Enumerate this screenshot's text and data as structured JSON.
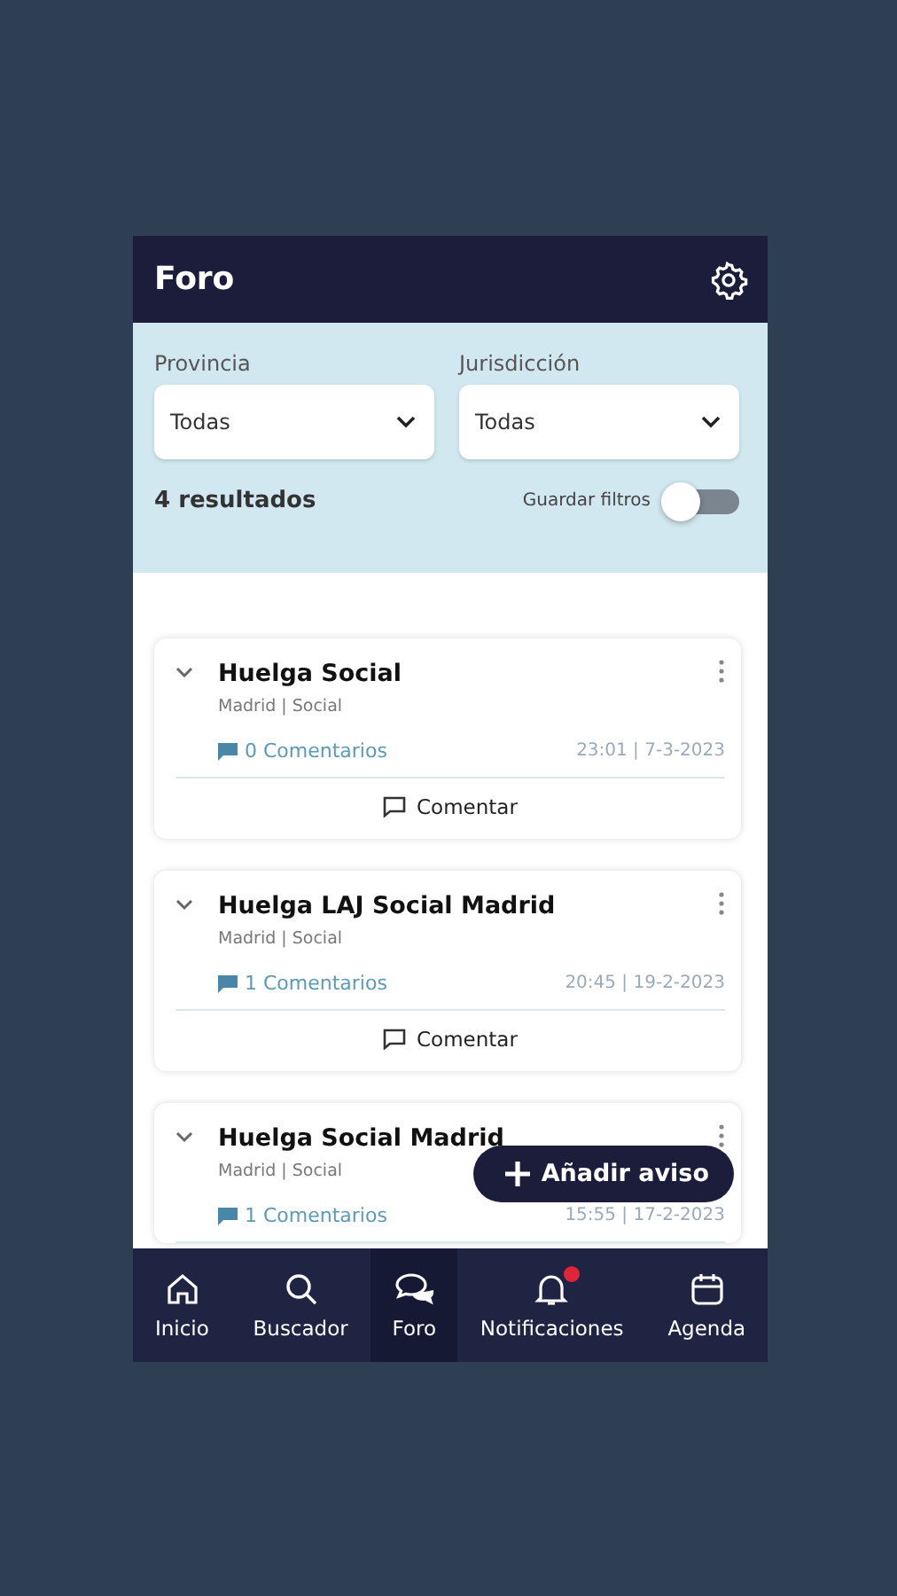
{
  "header": {
    "title": "Foro"
  },
  "filters": [
    {
      "label": "Provincia",
      "value": "Todas"
    },
    {
      "label": "Jurisdicción",
      "value": "Todas"
    }
  ],
  "results": "4 resultados",
  "save_filters": {
    "label": "Guardar filtros",
    "on": false
  },
  "posts": [
    {
      "title": "Huelga Social",
      "meta": "Madrid | Social",
      "comments": "0 Comentarios",
      "time": "23:01 | 7-3-2023",
      "action": "Comentar",
      "expanded": false
    },
    {
      "title": "Huelga LAJ Social Madrid",
      "meta": "Madrid | Social",
      "comments": "1 Comentarios",
      "time": "20:45 | 19-2-2023",
      "action": "Comentar",
      "expanded": false
    },
    {
      "title": "Huelga Social Madrid",
      "meta": "Madrid | Social",
      "comments": "1 Comentarios",
      "time": "15:55 | 17-2-2023",
      "expanded": false
    }
  ],
  "fab": {
    "label": "Añadir aviso"
  },
  "nav": [
    {
      "kind": "home",
      "label": "Inicio",
      "selected": false,
      "badge": false
    },
    {
      "kind": "search",
      "label": "Buscador",
      "selected": false,
      "badge": false
    },
    {
      "kind": "forum",
      "label": "Foro",
      "selected": true,
      "badge": false
    },
    {
      "kind": "bell",
      "label": "Notificaciones",
      "selected": false,
      "badge": true
    },
    {
      "kind": "calendar",
      "label": "Agenda",
      "selected": false,
      "badge": false
    }
  ]
}
